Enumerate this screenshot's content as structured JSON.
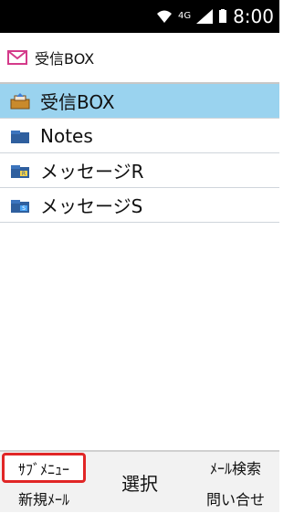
{
  "status": {
    "signal_label": "4G",
    "time": "8:00"
  },
  "header": {
    "title": "受信BOX"
  },
  "folders": [
    {
      "label": "受信BOX",
      "icon": "inbox-icon",
      "selected": true
    },
    {
      "label": "Notes",
      "icon": "folder-icon",
      "selected": false
    },
    {
      "label": "メッセージR",
      "icon": "folder-r-icon",
      "selected": false
    },
    {
      "label": "メッセージS",
      "icon": "folder-s-icon",
      "selected": false
    }
  ],
  "softkeys": {
    "left_top": "ｻﾌﾞﾒﾆｭｰ",
    "left_bottom": "新規ﾒｰﾙ",
    "center": "選択",
    "right_top": "ﾒｰﾙ検索",
    "right_bottom": "問い合せ"
  }
}
